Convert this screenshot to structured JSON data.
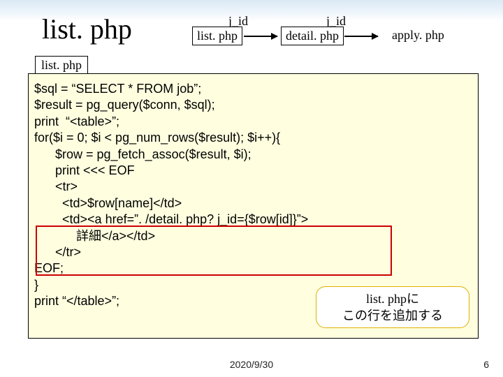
{
  "title": "list. php",
  "flow": {
    "label1": "j_id",
    "label2": "j_id",
    "box1": "list. php",
    "box2": "detail. php",
    "box3": "apply. php"
  },
  "tab": "list. php",
  "code_lines": [
    "$sql = “SELECT * FROM job”;",
    "$result = pg_query($conn, $sql);",
    "print  “<table>”;",
    "for($i = 0; $i < pg_num_rows($result); $i++){",
    "      $row = pg_fetch_assoc($result, $i);",
    "      print <<< EOF",
    "      <tr>",
    "        <td>$row[name]</td>",
    "        <td><a href=”. /detail. php? j_id={$row[id]}”>",
    "            詳細</a></td>",
    "      </tr>",
    "EOF;",
    "}",
    "print “</table>”;"
  ],
  "callout": "list. phpに\nこの行を追加する",
  "footer": {
    "date": "2020/9/30",
    "page": "6"
  }
}
